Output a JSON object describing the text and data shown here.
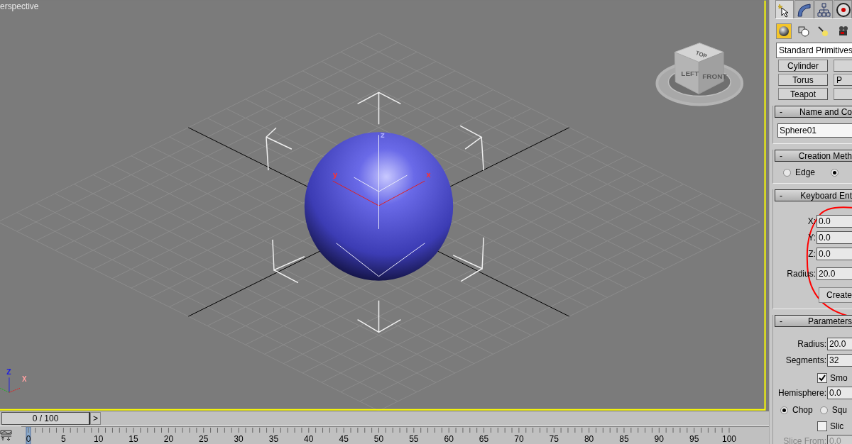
{
  "viewport": {
    "label": "erspective",
    "viewcube": {
      "top": "TOP",
      "left": "LEFT",
      "front": "FRONT"
    },
    "gizmo_axes": [
      "z",
      "y",
      "x"
    ],
    "tripod_axes": [
      "Z",
      "X"
    ]
  },
  "command_panel": {
    "tabs": [
      {
        "selected": true
      },
      {
        "selected": false
      },
      {
        "selected": false
      },
      {
        "selected": false
      }
    ],
    "categories": [
      {
        "selected": true
      },
      {
        "selected": false
      },
      {
        "selected": false
      },
      {
        "selected": false
      }
    ],
    "object_type": "Standard Primitives",
    "object_buttons": [
      {
        "left": "Cylinder"
      },
      {
        "left": "Torus",
        "right": "P"
      },
      {
        "left": "Teapot"
      }
    ],
    "rollouts": [
      {
        "kind": "name",
        "collapse": "-",
        "title": "Name and Co",
        "name": "Sphere01"
      },
      {
        "kind": "creation",
        "collapse": "-",
        "title": "Creation Meth",
        "options": [
          {
            "label": "Edge",
            "selected": false
          },
          {
            "selected": true
          }
        ]
      },
      {
        "kind": "keyboard",
        "collapse": "-",
        "title": "Keyboard Ent",
        "circled": true,
        "fields": [
          {
            "label": "X:",
            "value": "0.0"
          },
          {
            "label": "Y:",
            "value": "0.0"
          },
          {
            "label": "Z:",
            "value": "0.0"
          },
          {
            "label": "Radius:",
            "value": "20.0"
          }
        ],
        "button": "Create"
      },
      {
        "kind": "parameters",
        "collapse": "-",
        "title": "Parameters",
        "rows": [
          {
            "kind": "spinner",
            "label": "Radius:",
            "value": "20.0",
            "disabled": false
          },
          {
            "kind": "spinner",
            "label": "Segments:",
            "value": "32",
            "disabled": false
          },
          {
            "kind": "checkbox",
            "label": "Smo",
            "checked": true
          },
          {
            "kind": "spinner",
            "label": "Hemisphere:",
            "value": "0.0",
            "disabled": false
          },
          {
            "kind": "radios",
            "options": [
              {
                "label": "Chop",
                "selected": true
              },
              {
                "label": "Squ",
                "selected": false
              }
            ]
          },
          {
            "kind": "checkbox",
            "label": "Slic",
            "checked": false
          },
          {
            "kind": "spinner",
            "label": "Slice From:",
            "value": "0.0",
            "disabled": true
          }
        ]
      }
    ]
  },
  "time_slider": {
    "label": "0 / 100",
    "next": ">",
    "level": 0
  },
  "timeline": {
    "ticks": [
      "0",
      "5",
      "10",
      "15",
      "20",
      "25",
      "30",
      "35",
      "40",
      "45",
      "50",
      "55",
      "60",
      "65",
      "70",
      "75",
      "80",
      "85",
      "90",
      "95",
      "100"
    ]
  }
}
